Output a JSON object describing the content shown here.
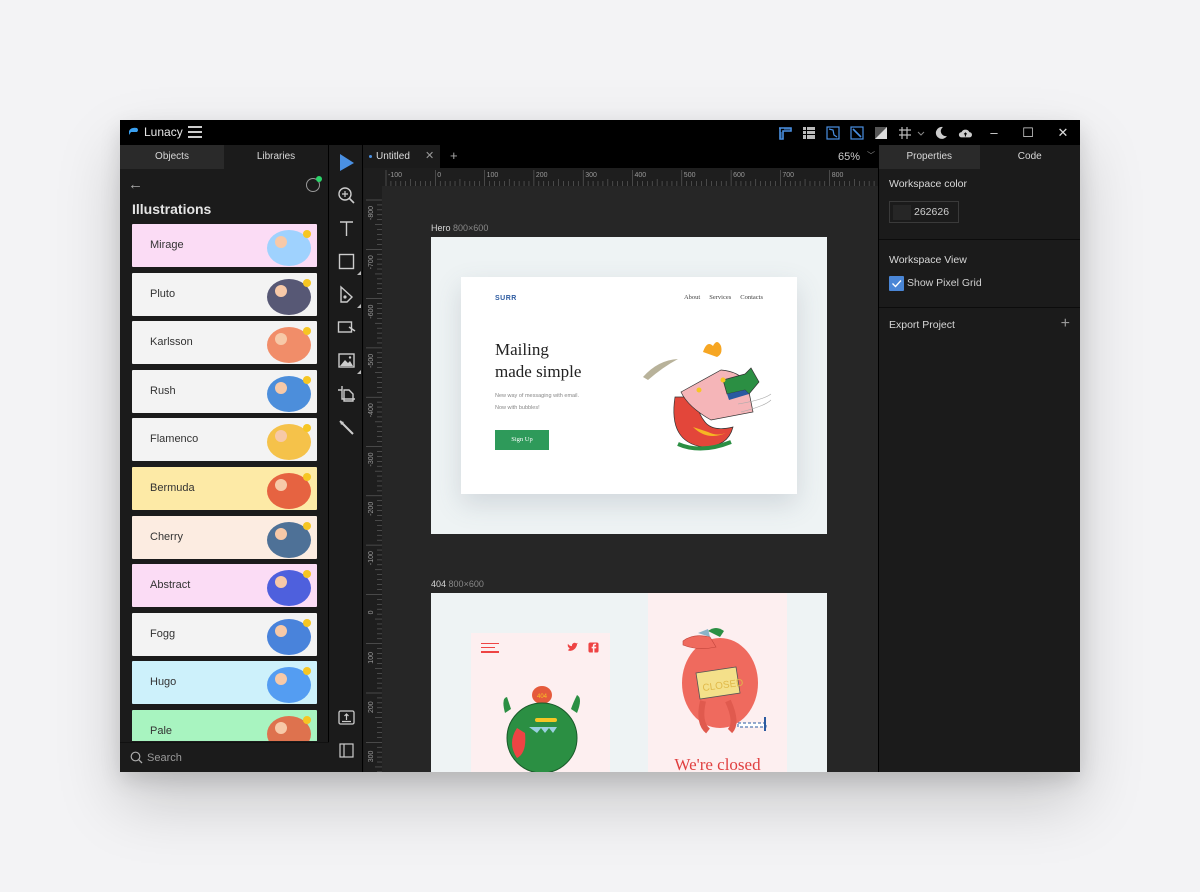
{
  "app": {
    "title": "Lunacy",
    "window_controls": {
      "minimize": "–",
      "maximize": "☐",
      "close": "✕"
    }
  },
  "titlebar_icons": [
    {
      "name": "rulers-icon",
      "active": true
    },
    {
      "name": "layout-grid-icon",
      "active": false
    },
    {
      "name": "snap-to-path-icon",
      "active": true
    },
    {
      "name": "snap-to-pixel-icon",
      "active": true
    },
    {
      "name": "contrast-icon",
      "active": false
    },
    {
      "name": "grid-icon",
      "active": false
    },
    {
      "name": "theme-moon-icon",
      "active": false
    },
    {
      "name": "cloud-upload-icon",
      "active": false
    }
  ],
  "left_panel": {
    "tabs": [
      {
        "label": "Objects",
        "active": false
      },
      {
        "label": "Libraries",
        "active": true
      }
    ],
    "title": "Illustrations",
    "libraries": [
      {
        "label": "Mirage",
        "bg": "#fbdcf5",
        "accent": "#8ed0ff"
      },
      {
        "label": "Pluto",
        "bg": "#f3f3f3",
        "accent": "#3b3c5e"
      },
      {
        "label": "Karlsson",
        "bg": "#f3f3f3",
        "accent": "#f07a50"
      },
      {
        "label": "Rush",
        "bg": "#f3f3f3",
        "accent": "#2e7bd6"
      },
      {
        "label": "Flamenco",
        "bg": "#f3f3f3",
        "accent": "#f5b92b"
      },
      {
        "label": "Bermuda",
        "bg": "#fdeaa6",
        "accent": "#e24b2f"
      },
      {
        "label": "Cherry",
        "bg": "#fcece1",
        "accent": "#2f5c8a"
      },
      {
        "label": "Abstract",
        "bg": "#fbdcf5",
        "accent": "#2f4ad8"
      },
      {
        "label": "Fogg",
        "bg": "#f3f3f3",
        "accent": "#2a6fd6"
      },
      {
        "label": "Hugo",
        "bg": "#cdf1fb",
        "accent": "#3e8ef0"
      },
      {
        "label": "Pale",
        "bg": "#a8f4c0",
        "accent": "#e85b3a"
      }
    ],
    "search_placeholder": "Search"
  },
  "tools": [
    {
      "name": "select-tool",
      "active": true
    },
    {
      "name": "zoom-tool",
      "active": false
    },
    {
      "name": "text-tool",
      "active": false
    },
    {
      "name": "rectangle-tool",
      "active": false,
      "submenu": true
    },
    {
      "name": "pen-tool",
      "active": false,
      "submenu": true
    },
    {
      "name": "hotspot-tool",
      "active": false
    },
    {
      "name": "image-tool",
      "active": false,
      "submenu": true
    },
    {
      "name": "artboard-tool",
      "active": false
    },
    {
      "name": "slice-tool",
      "active": false
    }
  ],
  "document": {
    "tab_label": "Untitled",
    "unsaved": true,
    "zoom": "65%"
  },
  "rulers": {
    "horizontal": [
      "-100",
      "0",
      "100",
      "200",
      "300",
      "400",
      "500",
      "600",
      "700",
      "800"
    ],
    "vertical": [
      "-800",
      "-700",
      "-600",
      "-500",
      "-400",
      "-300",
      "-200",
      "-100",
      "0",
      "100",
      "200",
      "300"
    ]
  },
  "artboards": [
    {
      "name": "Hero",
      "size": "800×600",
      "content": {
        "logo": "SURR",
        "nav": [
          "About",
          "Services",
          "Contacts"
        ],
        "headline_1": "Mailing",
        "headline_2": "made simple",
        "sub_1": "New way of messaging with email.",
        "sub_2": "Now with bubbles!",
        "cta": "Sign Up"
      }
    },
    {
      "name": "404",
      "size": "800×600",
      "content": {
        "closed_sign": "CLOSED",
        "badge": "404",
        "heading_partial": "We're closed"
      }
    }
  ],
  "right_panel": {
    "tabs": [
      {
        "label": "Properties",
        "active": true
      },
      {
        "label": "Code",
        "active": false
      }
    ],
    "workspace_color": {
      "heading": "Workspace color",
      "value": "262626"
    },
    "workspace_view": {
      "heading": "Workspace View",
      "show_pixel_grid_label": "Show Pixel Grid",
      "show_pixel_grid": true
    },
    "export": {
      "heading": "Export Project",
      "add_label": "+"
    }
  },
  "colors": {
    "accent": "#4a86d6",
    "workspace": "#262626",
    "cta_green": "#2e9a5a"
  }
}
